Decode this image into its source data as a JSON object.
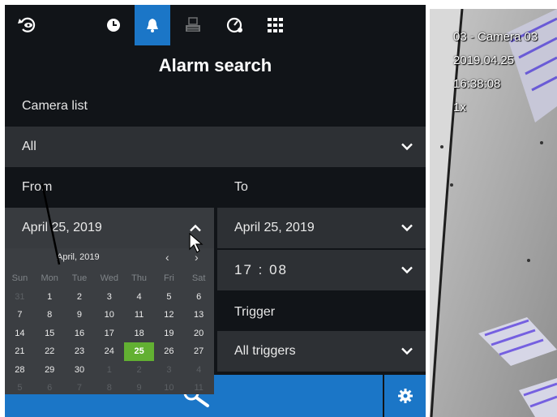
{
  "toolbar": {
    "icons": [
      "live-view-icon",
      "playback-clock-icon",
      "alarm-bell-icon",
      "recording-icon",
      "settings-gauge-icon",
      "layout-grid-icon"
    ],
    "active": "alarm-bell-icon"
  },
  "title": "Alarm search",
  "camera_list": {
    "label": "Camera list",
    "value": "All"
  },
  "from": {
    "label": "From",
    "date": "April 25, 2019"
  },
  "to": {
    "label": "To",
    "date": "April 25, 2019",
    "time": "17 : 08"
  },
  "trigger": {
    "label": "Trigger",
    "value": "All triggers"
  },
  "calendar": {
    "month_label": "April, 2019",
    "prev": "‹",
    "next": "›",
    "weekdays": [
      "Sun",
      "Mon",
      "Tue",
      "Wed",
      "Thu",
      "Fri",
      "Sat"
    ],
    "weeks": [
      [
        "31",
        "1",
        "2",
        "3",
        "4",
        "5",
        "6"
      ],
      [
        "7",
        "8",
        "9",
        "10",
        "11",
        "12",
        "13"
      ],
      [
        "14",
        "15",
        "16",
        "17",
        "18",
        "19",
        "20"
      ],
      [
        "21",
        "22",
        "23",
        "24",
        "25",
        "26",
        "27"
      ],
      [
        "28",
        "29",
        "30",
        "1",
        "2",
        "3",
        "4"
      ],
      [
        "5",
        "6",
        "7",
        "8",
        "9",
        "10",
        "11"
      ]
    ],
    "selected": "25"
  },
  "camera_view": {
    "name": "03 - Camera 03",
    "date": "2019.04.25",
    "time": "16:38:08",
    "speed": "1x"
  },
  "colors": {
    "accent": "#1b76c7",
    "selected_day": "#62b032",
    "panel": "#111418",
    "row": "#2d3034"
  }
}
